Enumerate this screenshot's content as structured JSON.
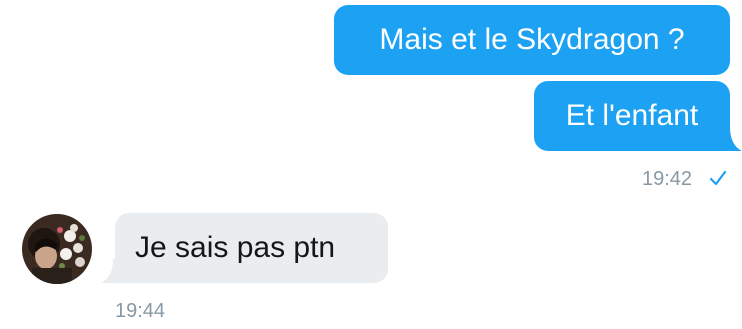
{
  "messages": {
    "outgoing_1": "Mais et le Skydragon ?",
    "outgoing_2": "Et l'enfant",
    "outgoing_time": "19:42",
    "incoming_1": "Je sais pas ptn",
    "incoming_time": "19:44"
  },
  "status": {
    "read_icon": "check-icon"
  },
  "colors": {
    "outgoing_bubble": "#1da1f2",
    "incoming_bubble": "#e9edf0",
    "timestamp": "#8899a6"
  }
}
